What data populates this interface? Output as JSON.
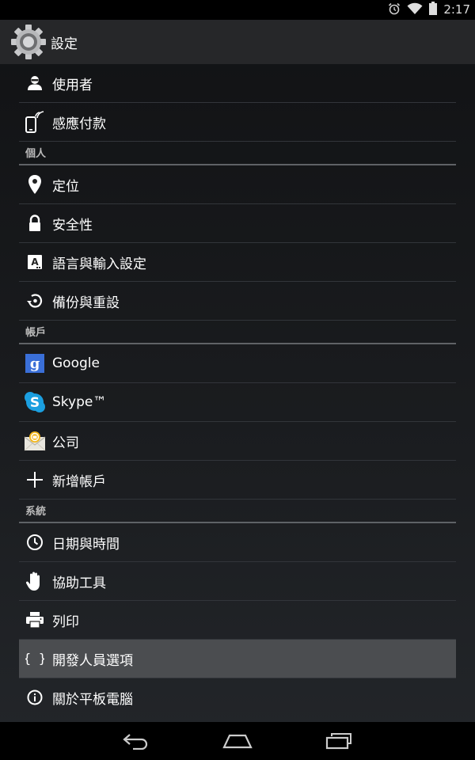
{
  "status_bar": {
    "time": "2:17",
    "icons": [
      "alarm-icon",
      "wifi-icon",
      "battery-icon"
    ]
  },
  "action_bar": {
    "title": "設定",
    "icon": "settings-gear-icon"
  },
  "settings": {
    "device_items": [
      {
        "label": "使用者",
        "icon": "user-icon"
      },
      {
        "label": "感應付款",
        "icon": "tap-pay-icon"
      }
    ],
    "personal": {
      "header": "個人",
      "items": [
        {
          "label": "定位",
          "icon": "location-icon"
        },
        {
          "label": "安全性",
          "icon": "lock-icon"
        },
        {
          "label": "語言與輸入設定",
          "icon": "language-icon"
        },
        {
          "label": "備份與重設",
          "icon": "backup-icon"
        }
      ]
    },
    "accounts": {
      "header": "帳戶",
      "items": [
        {
          "label": "Google",
          "icon": "google-icon"
        },
        {
          "label": "Skype™",
          "icon": "skype-icon"
        },
        {
          "label": "公司",
          "icon": "work-mail-icon"
        },
        {
          "label": "新增帳戶",
          "icon": "add-icon"
        }
      ]
    },
    "system": {
      "header": "系統",
      "items": [
        {
          "label": "日期與時間",
          "icon": "clock-icon"
        },
        {
          "label": "協助工具",
          "icon": "hand-icon"
        },
        {
          "label": "列印",
          "icon": "printer-icon"
        },
        {
          "label": "開發人員選項",
          "icon": "braces-icon",
          "selected": true
        },
        {
          "label": "關於平板電腦",
          "icon": "info-icon"
        }
      ]
    }
  },
  "nav_bar": {
    "buttons": [
      "back-icon",
      "home-icon",
      "recent-apps-icon"
    ]
  },
  "colors": {
    "status_bar_bg": "#000000",
    "action_bar_bg": "#262729",
    "selected_row_bg": "#4b4d50",
    "google_blue": "#3a6fd8",
    "skype_blue": "#1b9fe0"
  }
}
